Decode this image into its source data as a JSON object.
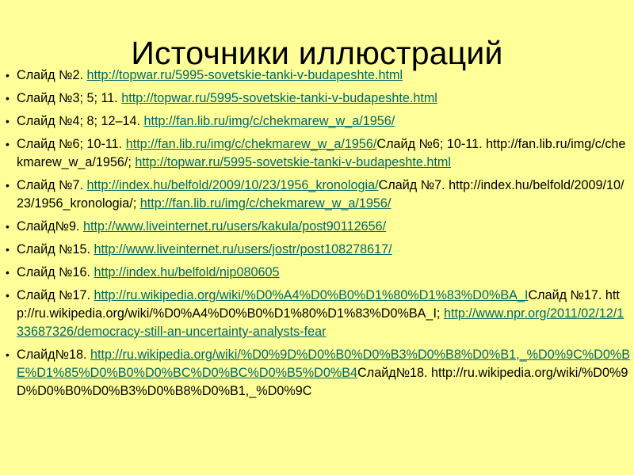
{
  "title": "Источники иллюстраций",
  "bullet_char": "•",
  "items": [
    {
      "label": "Слайд №2. ",
      "link1": "http://topwar.ru/5995-sovetskie-tanki-v-budapeshte.html"
    },
    {
      "label": "Слайд №3; 5; 11. ",
      "link1": "http://topwar.ru/5995-sovetskie-tanki-v-budapeshte.html"
    },
    {
      "label": "Слайд №4; 8; 12–14. ",
      "link1": "http://fan.lib.ru/img/c/chekmarew_w_a/1956/"
    },
    {
      "label": "Слайд №6; 10-11. ",
      "link1": "http://fan.lib.ru/img/c/chekmarew_w_a/1956/",
      "mid": "Слайд №6; 10-11. http://fan.lib.ru/img/c/chekmarew_w_a/1956/; ",
      "link2": "http://topwar.ru/5995-sovetskie-tanki-v-budapeshte.html"
    },
    {
      "label": "Слайд №7. ",
      "link1": "http://index.hu/belfold/2009/10/23/1956_kronologia/",
      "mid": "Слайд №7. http://index.hu/belfold/2009/10/23/1956_kronologia/; ",
      "link2": "http://fan.lib.ru/img/c/chekmarew_w_a/1956/"
    },
    {
      "label": "Слайд№9. ",
      "link1": "http://www.liveinternet.ru/users/kakula/post90112656/"
    },
    {
      "label": "Слайд №15. ",
      "link1": "http://www.liveinternet.ru/users/jostr/post108278617/"
    },
    {
      "label": "Слайд №16. ",
      "link1": "http://index.hu/belfold/nip080605"
    },
    {
      "label": "Слайд №17. ",
      "link1": "http://ru.wikipedia.org/wiki/%D0%A4%D0%B0%D1%80%D1%83%D0%BA_I",
      "mid": "Слайд №17. http://ru.wikipedia.org/wiki/%D0%A4%D0%B0%D1%80%D1%83%D0%BA_I; ",
      "link2": "http://www.npr.org/2011/02/12/133687326/democracy-still-an-uncertainty-analysts-fear"
    },
    {
      "label": "Слайд№18. ",
      "link1": "http://ru.wikipedia.org/wiki/%D0%9D%D0%B0%D0%B3%D0%B8%D0%B1,_%D0%9C%D0%BE%D1%85%D0%B0%D0%BC%D0%BC%D0%B5%D0%B4",
      "mid": "Слайд№18. http://ru.wikipedia.org/wiki/%D0%9D%D0%B0%D0%B3%D0%B8%D0%B1,_%D0%9C"
    }
  ]
}
